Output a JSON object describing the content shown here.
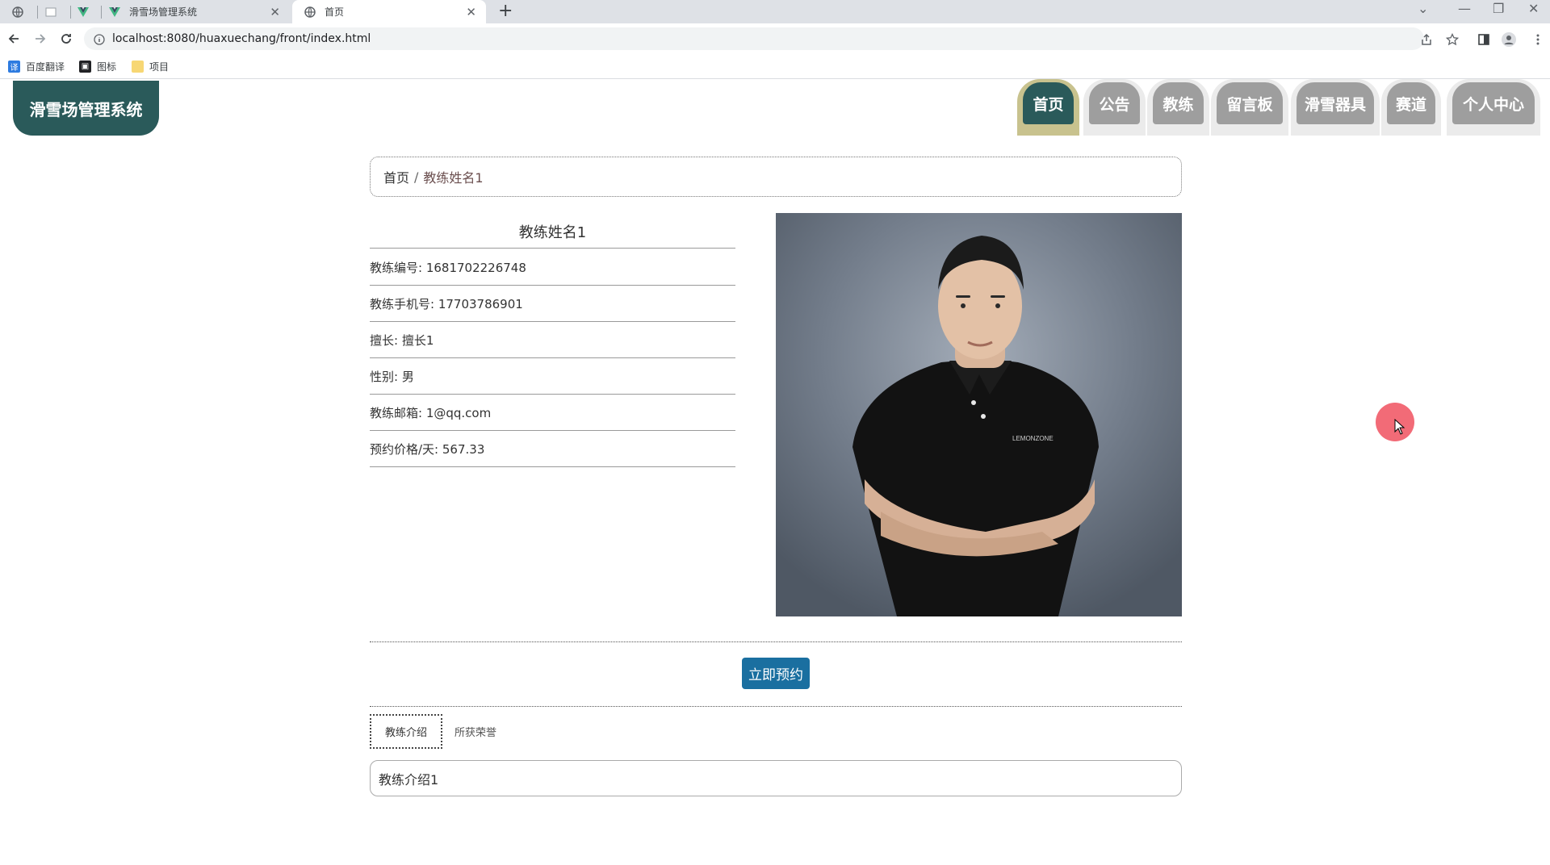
{
  "browser": {
    "tabs": [
      {
        "title": ""
      },
      {
        "title": ""
      },
      {
        "title": ""
      },
      {
        "title": "滑雪场管理系统"
      },
      {
        "title": "首页"
      }
    ],
    "url": "localhost:8080/huaxuechang/front/index.html",
    "bookmarks": [
      {
        "label": "百度翻译",
        "icon": "translate-icon"
      },
      {
        "label": "图标",
        "icon": "image-icon"
      },
      {
        "label": "项目",
        "icon": "folder-icon"
      }
    ]
  },
  "site": {
    "logo": "滑雪场管理系统",
    "nav": [
      "首页",
      "公告",
      "教练",
      "留言板",
      "滑雪器具",
      "赛道",
      "个人中心"
    ],
    "active_nav": 0
  },
  "breadcrumb": {
    "home": "首页",
    "separator": "/",
    "current": "教练姓名1"
  },
  "coach": {
    "name": "教练姓名1",
    "fields": [
      "教练编号: 1681702226748",
      "教练手机号: 17703786901",
      "擅长: 擅长1",
      "性别: 男",
      "教练邮箱: 1@qq.com",
      "预约价格/天: 567.33"
    ],
    "photo_text": "LEMONZONE"
  },
  "actions": {
    "book": "立即预约"
  },
  "detail_tabs": [
    "教练介绍",
    "所获荣誉"
  ],
  "intro": "教练介绍1",
  "colors": {
    "brand": "#2a5a5a",
    "nav_active_ring": "#c8c28e",
    "nav_off": "#9e9e9e",
    "button": "#1a6fa0",
    "cursor": "#f26b77"
  }
}
